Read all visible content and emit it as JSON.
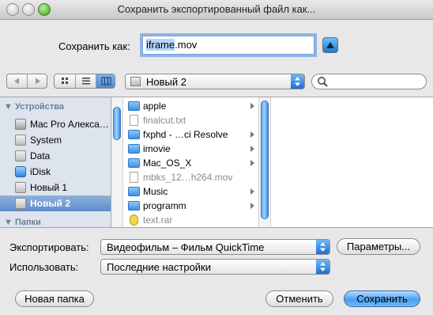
{
  "window": {
    "title": "Сохранить экспортированный файл как..."
  },
  "save_as": {
    "label": "Сохранить как:",
    "filename_base": "iframe",
    "filename_ext": ".mov"
  },
  "toolbar": {
    "location": "Новый 2",
    "search_placeholder": ""
  },
  "sidebar": {
    "section_devices": "▼ Устройства",
    "items": [
      {
        "label": "Mac Pro Алекса…",
        "icon": "computer-icon",
        "selected": false
      },
      {
        "label": "System",
        "icon": "disk-icon",
        "selected": false
      },
      {
        "label": "Data",
        "icon": "disk-icon",
        "selected": false
      },
      {
        "label": "iDisk",
        "icon": "idisk-icon",
        "selected": false
      },
      {
        "label": "Новый 1",
        "icon": "disk-icon",
        "selected": false
      },
      {
        "label": "Новый 2",
        "icon": "disk-icon",
        "selected": true
      }
    ],
    "section_places": "▼ Папки"
  },
  "files": [
    {
      "name": "apple",
      "type": "folder"
    },
    {
      "name": "finalcut.txt",
      "type": "file"
    },
    {
      "name": "fxphd - …ci Resolve",
      "type": "folder"
    },
    {
      "name": "imovie",
      "type": "folder"
    },
    {
      "name": "Mac_OS_X",
      "type": "folder"
    },
    {
      "name": "mbks_12…h264.mov",
      "type": "file"
    },
    {
      "name": "Music",
      "type": "folder"
    },
    {
      "name": "programm",
      "type": "folder"
    },
    {
      "name": "text.rar",
      "type": "file"
    }
  ],
  "options": {
    "export_label": "Экспортировать:",
    "export_value": "Видеофильм – Фильм QuickTime",
    "params_button": "Параметры...",
    "use_label": "Использовать:",
    "use_value": "Последние настройки"
  },
  "footer": {
    "new_folder": "Новая папка",
    "cancel": "Отменить",
    "save": "Сохранить"
  },
  "colors": {
    "accent": "#3d89de",
    "selected_sidebar": "#5f8ccb"
  }
}
